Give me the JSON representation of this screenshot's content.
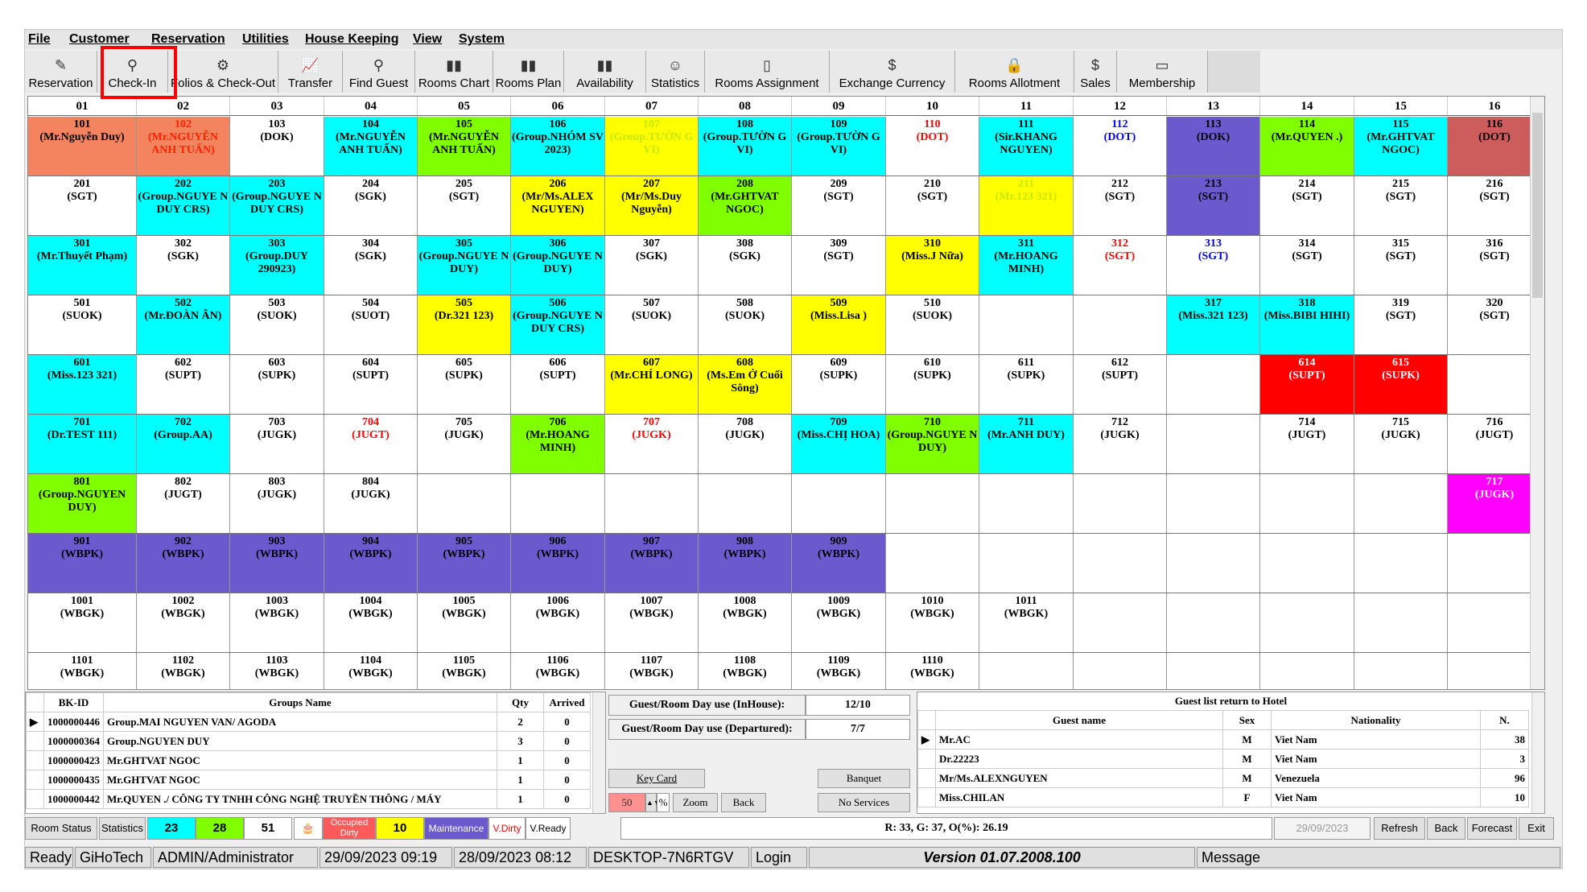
{
  "menu": [
    "File",
    "Customer",
    "Reservation",
    "Utilities",
    "House Keeping",
    "View",
    "System"
  ],
  "toolbar": [
    {
      "label": "Reservation",
      "icon": "pen-icon"
    },
    {
      "label": "Check-In",
      "icon": "binoculars-icon"
    },
    {
      "label": "Folios & Check-Out",
      "icon": "search-icon"
    },
    {
      "label": "Transfer",
      "icon": "chart-line-icon"
    },
    {
      "label": "Find Guest",
      "icon": "binoculars-icon"
    },
    {
      "label": "Rooms Chart",
      "icon": "bar-chart-icon"
    },
    {
      "label": "Rooms Plan",
      "icon": "bar-chart-icon"
    },
    {
      "label": "Availability",
      "icon": "bar-chart-icon"
    },
    {
      "label": "Statistics",
      "icon": "people-icon"
    },
    {
      "label": "Rooms Assignment",
      "icon": "door-icon"
    },
    {
      "label": "Exchange Currency",
      "icon": "currency-icon"
    },
    {
      "label": "Rooms Allotment",
      "icon": "lock-icon"
    },
    {
      "label": "Sales",
      "icon": "money-icon"
    },
    {
      "label": "Membership",
      "icon": "card-icon"
    }
  ],
  "columns": [
    "01",
    "02",
    "03",
    "04",
    "05",
    "06",
    "07",
    "08",
    "09",
    "10",
    "11",
    "12",
    "13",
    "14",
    "15",
    "16"
  ],
  "rooms": [
    [
      {
        "t": "101\n(Mr.Nguyễn Duy)",
        "bg": "#f4845f"
      },
      {
        "t": "102\n(Mr.NGUYỄN ANH TUẤN)",
        "bg": "#f4845f",
        "fg": "#ff2200"
      },
      {
        "t": "103\n(DOK)"
      },
      {
        "t": "104\n(Mr.NGUYỄN ANH TUẤN)",
        "bg": "#00ffff"
      },
      {
        "t": "105\n(Mr.NGUYỄN ANH TUẤN)",
        "bg": "#80ff00"
      },
      {
        "t": "106\n(Group.NHÓM SV 2023)",
        "bg": "#00ffff"
      },
      {
        "t": "107\n(Group.TƯỜN G VI)",
        "bg": "#ffff00",
        "fg": "#c8e800"
      },
      {
        "t": "108\n(Group.TƯỜN G VI)",
        "bg": "#00ffff"
      },
      {
        "t": "109\n(Group.TƯỜN G VI)",
        "bg": "#00ffff"
      },
      {
        "t": "110\n(DOT)",
        "fg": "#ff0000"
      },
      {
        "t": "111\n(Sir.KHANG NGUYEN)",
        "bg": "#00ffff"
      },
      {
        "t": "112\n(DOT)",
        "fg": "#0000ff"
      },
      {
        "t": "113\n(DOK)",
        "bg": "#6a5acd"
      },
      {
        "t": "114\n(Mr.QUYEN .)",
        "bg": "#80ff00"
      },
      {
        "t": "115\n(Mr.GHTVAT NGOC)",
        "bg": "#00ffff"
      },
      {
        "t": "116\n(DOT)",
        "bg": "#cd5c5c"
      }
    ],
    [
      {
        "t": "201\n(SGT)"
      },
      {
        "t": "202\n(Group.NGUYE N DUY CRS)",
        "bg": "#00ffff"
      },
      {
        "t": "203\n(Group.NGUYE N DUY CRS)",
        "bg": "#00ffff"
      },
      {
        "t": "204\n(SGK)"
      },
      {
        "t": "205\n(SGT)"
      },
      {
        "t": "206\n(Mr/Ms.ALEX NGUYEN)",
        "bg": "#ffff00"
      },
      {
        "t": "207\n(Mr/Ms.Duy Nguyễn)",
        "bg": "#ffff00"
      },
      {
        "t": "208\n(Mr.GHTVAT NGOC)",
        "bg": "#80ff00"
      },
      {
        "t": "209\n(SGT)"
      },
      {
        "t": "210\n(SGT)"
      },
      {
        "t": "211\n(Mr.123 321)",
        "bg": "#ffff00",
        "fg": "#c8e800"
      },
      {
        "t": "212\n(SGT)"
      },
      {
        "t": "213\n(SGT)",
        "bg": "#6a5acd"
      },
      {
        "t": "214\n(SGT)"
      },
      {
        "t": "215\n(SGT)"
      },
      {
        "t": "216\n(SGT)"
      }
    ],
    [
      {
        "t": "301\n(Mr.Thuyết Phạm)",
        "bg": "#00ffff"
      },
      {
        "t": "302\n(SGK)"
      },
      {
        "t": "303\n(Group.DUY 290923)",
        "bg": "#00ffff"
      },
      {
        "t": "304\n(SGK)"
      },
      {
        "t": "305\n(Group.NGUYE N DUY)",
        "bg": "#00ffff"
      },
      {
        "t": "306\n(Group.NGUYE N DUY)",
        "bg": "#00ffff"
      },
      {
        "t": "307\n(SGK)"
      },
      {
        "t": "308\n(SGK)"
      },
      {
        "t": "309\n(SGT)"
      },
      {
        "t": "310\n(Miss.J Nữa)",
        "bg": "#ffff00"
      },
      {
        "t": "311\n(Mr.HOANG MINH)",
        "bg": "#00ffff"
      },
      {
        "t": "312\n(SGT)",
        "fg": "#ff0000"
      },
      {
        "t": "313\n(SGT)",
        "fg": "#0000ff"
      },
      {
        "t": "314\n(SGT)"
      },
      {
        "t": "315\n(SGT)"
      },
      {
        "t": "316\n(SGT)"
      }
    ],
    [
      {
        "t": "501\n(SUOK)"
      },
      {
        "t": "502\n(Mr.ĐOÀN ÂN)",
        "bg": "#00ffff"
      },
      {
        "t": "503\n(SUOK)"
      },
      {
        "t": "504\n(SUOT)"
      },
      {
        "t": "505\n(Dr.321 123)",
        "bg": "#ffff00"
      },
      {
        "t": "506\n(Group.NGUYE N DUY CRS)",
        "bg": "#00ffff"
      },
      {
        "t": "507\n(SUOK)"
      },
      {
        "t": "508\n(SUOK)"
      },
      {
        "t": "509\n(Miss.Lisa )",
        "bg": "#ffff00"
      },
      {
        "t": "510\n(SUOK)"
      },
      {
        "t": ""
      },
      {
        "t": ""
      },
      {
        "t": "317\n(Miss.321 123)",
        "bg": "#00ffff"
      },
      {
        "t": "318\n(Miss.BIBI HIHI)",
        "bg": "#00ffff"
      },
      {
        "t": "319\n(SGT)"
      },
      {
        "t": "320\n(SGT)"
      }
    ],
    [
      {
        "t": "601\n(Miss.123 321)",
        "bg": "#00ffff"
      },
      {
        "t": "602\n(SUPT)"
      },
      {
        "t": "603\n(SUPK)"
      },
      {
        "t": "604\n(SUPT)"
      },
      {
        "t": "605\n(SUPK)"
      },
      {
        "t": "606\n(SUPT)"
      },
      {
        "t": "607\n(Mr.CHÍ LONG)",
        "bg": "#ffff00"
      },
      {
        "t": "608\n(Ms.Em Ở Cuối Sông)",
        "bg": "#ffff00"
      },
      {
        "t": "609\n(SUPK)"
      },
      {
        "t": "610\n(SUPK)"
      },
      {
        "t": "611\n(SUPK)"
      },
      {
        "t": "612\n(SUPT)"
      },
      {
        "t": ""
      },
      {
        "t": "614\n(SUPT)",
        "bg": "#ff0000",
        "fg": "#ffffff"
      },
      {
        "t": "615\n(SUPK)",
        "bg": "#ff0000",
        "fg": "#ffffff"
      },
      {
        "t": ""
      }
    ],
    [
      {
        "t": "701\n(Dr.TEST 111)",
        "bg": "#00ffff"
      },
      {
        "t": "702\n(Group.AA)",
        "bg": "#00ffff"
      },
      {
        "t": "703\n(JUGK)"
      },
      {
        "t": "704\n(JUGT)",
        "fg": "#ff0000"
      },
      {
        "t": "705\n(JUGK)"
      },
      {
        "t": "706\n(Mr.HOANG MINH)",
        "bg": "#80ff00"
      },
      {
        "t": "707\n(JUGK)",
        "fg": "#ff0000"
      },
      {
        "t": "708\n(JUGK)"
      },
      {
        "t": "709\n(Miss.CHỊ HOA)",
        "bg": "#00ffff"
      },
      {
        "t": "710\n(Group.NGUYE N DUY)",
        "bg": "#80ff00"
      },
      {
        "t": "711\n(Mr.ANH DUY)",
        "bg": "#00ffff"
      },
      {
        "t": "712\n(JUGK)"
      },
      {
        "t": ""
      },
      {
        "t": "714\n(JUGT)"
      },
      {
        "t": "715\n(JUGK)"
      },
      {
        "t": "716\n(JUGT)"
      }
    ],
    [
      {
        "t": "801\n(Group.NGUYEN DUY)",
        "bg": "#80ff00"
      },
      {
        "t": "802\n(JUGT)"
      },
      {
        "t": "803\n(JUGK)"
      },
      {
        "t": "804\n(JUGK)"
      },
      {
        "t": ""
      },
      {
        "t": ""
      },
      {
        "t": ""
      },
      {
        "t": ""
      },
      {
        "t": ""
      },
      {
        "t": ""
      },
      {
        "t": ""
      },
      {
        "t": ""
      },
      {
        "t": ""
      },
      {
        "t": ""
      },
      {
        "t": ""
      },
      {
        "t": "717\n(JUGK)",
        "bg": "#ff00ff",
        "fg": "#ffffff"
      }
    ],
    [
      {
        "t": "901\n(WBPK)",
        "bg": "#6a5acd"
      },
      {
        "t": "902\n(WBPK)",
        "bg": "#6a5acd"
      },
      {
        "t": "903\n(WBPK)",
        "bg": "#6a5acd"
      },
      {
        "t": "904\n(WBPK)",
        "bg": "#6a5acd"
      },
      {
        "t": "905\n(WBPK)",
        "bg": "#6a5acd"
      },
      {
        "t": "906\n(WBPK)",
        "bg": "#6a5acd"
      },
      {
        "t": "907\n(WBPK)",
        "bg": "#6a5acd"
      },
      {
        "t": "908\n(WBPK)",
        "bg": "#6a5acd"
      },
      {
        "t": "909\n(WBPK)",
        "bg": "#6a5acd"
      },
      {
        "t": ""
      },
      {
        "t": ""
      },
      {
        "t": ""
      },
      {
        "t": ""
      },
      {
        "t": ""
      },
      {
        "t": ""
      },
      {
        "t": ""
      }
    ],
    [
      {
        "t": "1001\n(WBGK)"
      },
      {
        "t": "1002\n(WBGK)"
      },
      {
        "t": "1003\n(WBGK)"
      },
      {
        "t": "1004\n(WBGK)"
      },
      {
        "t": "1005\n(WBGK)"
      },
      {
        "t": "1006\n(WBGK)"
      },
      {
        "t": "1007\n(WBGK)"
      },
      {
        "t": "1008\n(WBGK)"
      },
      {
        "t": "1009\n(WBGK)"
      },
      {
        "t": "1010\n(WBGK)"
      },
      {
        "t": "1011\n(WBGK)"
      },
      {
        "t": ""
      },
      {
        "t": ""
      },
      {
        "t": ""
      },
      {
        "t": ""
      },
      {
        "t": ""
      }
    ],
    [
      {
        "t": "1101\n(WBGK)"
      },
      {
        "t": "1102\n(WBGK)"
      },
      {
        "t": "1103\n(WBGK)"
      },
      {
        "t": "1104\n(WBGK)"
      },
      {
        "t": "1105\n(WBGK)"
      },
      {
        "t": "1106\n(WBGK)"
      },
      {
        "t": "1107\n(WBGK)"
      },
      {
        "t": "1108\n(WBGK)"
      },
      {
        "t": "1109\n(WBGK)"
      },
      {
        "t": "1110\n(WBGK)"
      },
      {
        "t": ""
      },
      {
        "t": ""
      },
      {
        "t": ""
      },
      {
        "t": ""
      },
      {
        "t": ""
      },
      {
        "t": ""
      }
    ]
  ],
  "groups": {
    "headers": [
      "BK-ID",
      "Groups Name",
      "Qty",
      "Arrived"
    ],
    "rows": [
      [
        "1000000446",
        "Group.MAI NGUYEN VAN/ AGODA",
        "2",
        "0"
      ],
      [
        "1000000364",
        "Group.NGUYEN DUY",
        "3",
        "0"
      ],
      [
        "1000000423",
        "Mr.GHTVAT NGOC",
        "1",
        "0"
      ],
      [
        "1000000435",
        "Mr.GHTVAT NGOC",
        "1",
        "0"
      ],
      [
        "1000000442",
        "Mr.QUYEN ./ CÔNG TY TNHH CÔNG NGHỆ TRUYỀN THÔNG / MÁY",
        "1",
        "0"
      ]
    ]
  },
  "mid": {
    "inhouse_label": "Guest/Room Day use (InHouse):",
    "inhouse_val": "12/10",
    "departed_label": "Guest/Room Day use (Departured):",
    "departed_val": "7/7",
    "key_card": "Key Card",
    "banquet": "Banquet",
    "zoom_val": "50",
    "zoom_unit": "%",
    "zoom": "Zoom",
    "back": "Back",
    "no_services": "No Services"
  },
  "guests": {
    "title": "Guest list return to Hotel",
    "headers": [
      "Guest name",
      "Sex",
      "Nationality",
      "N."
    ],
    "rows": [
      [
        "Mr.AC",
        "M",
        "Viet Nam",
        "38"
      ],
      [
        "Dr.22223",
        "M",
        "Viet Nam",
        "3"
      ],
      [
        "Mr/Ms.ALEXNGUYEN",
        "M",
        "Venezuela",
        "96"
      ],
      [
        "Miss.CHILAN",
        "F",
        "Viet Nam",
        "10"
      ]
    ]
  },
  "legend": {
    "room_status": "Room Status",
    "statistics": "Statistics",
    "c1": "23",
    "c2": "28",
    "c3": "51",
    "occ": "Occupied Dirty",
    "c4": "10",
    "maint": "Maintenance",
    "vdirty": "V.Dirty",
    "vready": "V.Ready",
    "summary": "R: 33, G: 37, O(%): 26.19",
    "date": "29/09/2023",
    "refresh": "Refresh",
    "back": "Back",
    "forecast": "Forecast",
    "exit": "Exit"
  },
  "status": {
    "ready": "Ready",
    "company": "GiHoTech",
    "user": "ADMIN/Administrator",
    "dt1": "29/09/2023 09:19",
    "dt2": "28/09/2023 08:12",
    "pc": "DESKTOP-7N6RTGV",
    "login": "Login",
    "version": "Version 01.07.2008.100",
    "message": "Message"
  }
}
